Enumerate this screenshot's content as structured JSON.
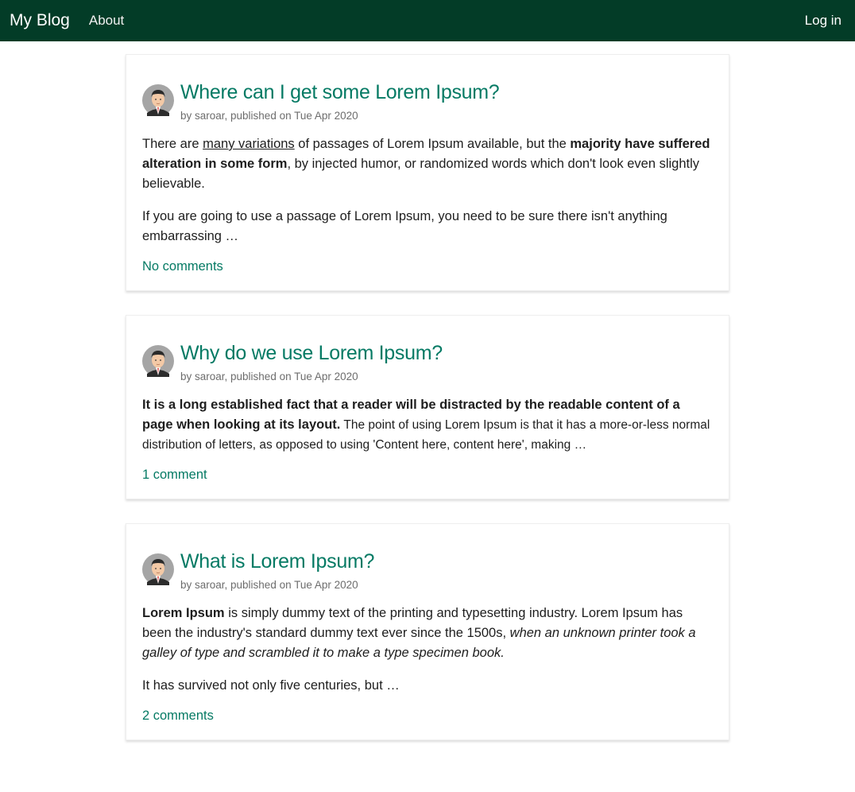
{
  "nav": {
    "brand": "My Blog",
    "about": "About",
    "login": "Log in"
  },
  "posts": [
    {
      "title": "Where can I get some Lorem Ipsum?",
      "meta": "by saroar, published on Tue Apr 2020",
      "p1": {
        "a": "There are ",
        "u": "many variations",
        "b": " of passages of Lorem Ipsum available, but the ",
        "bold": "majority have suffered alteration in some form",
        "c": ", by injected humor, or randomized words which don't look even slightly believable."
      },
      "p2": "If you are going to use a passage of Lorem Ipsum, you need to be sure there isn't anything embarrassing …",
      "comments": "No comments"
    },
    {
      "title": "Why do we use Lorem Ipsum?",
      "meta": "by saroar, published on Tue Apr 2020",
      "p1": {
        "bold": "It is a long established fact that a reader will be distracted by the readable content of a page when looking at its layout.",
        "small": " The point of using Lorem Ipsum is that it has a more-or-less normal distribution of letters, as opposed to using 'Content here, content here', making …"
      },
      "comments": "1 comment"
    },
    {
      "title": "What is Lorem Ipsum?",
      "meta": "by saroar, published on Tue Apr 2020",
      "p1": {
        "bold": "Lorem Ipsum",
        "a": " is simply dummy text of the printing and typesetting industry. Lorem Ipsum has been the industry's standard dummy text ever since the 1500s, ",
        "italic": "when an unknown printer took a galley of type and scrambled it to make a type specimen book."
      },
      "p2": "It has survived not only five centuries, but …",
      "comments": "2 comments"
    }
  ],
  "colors": {
    "nav_bg": "#033c27",
    "accent": "#057a64"
  },
  "icons": {
    "avatar": "avatar-icon"
  }
}
